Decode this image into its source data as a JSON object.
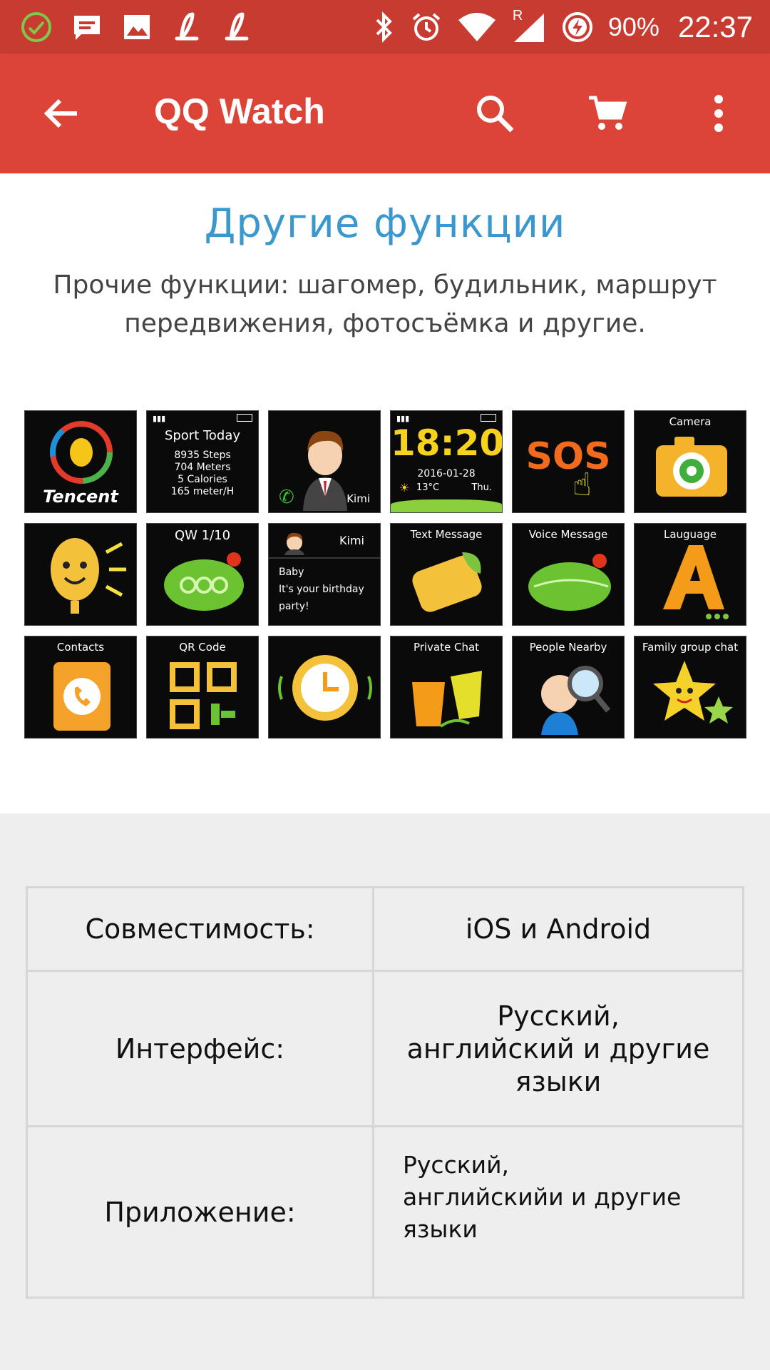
{
  "status_bar": {
    "battery_percent": "90%",
    "time": "22:37",
    "network_roaming_label": "R",
    "left_icons": [
      "check-circle-icon",
      "message-icon",
      "image-icon",
      "script-l-icon",
      "script-l-icon"
    ],
    "right_icons": [
      "bluetooth-icon",
      "alarm-icon",
      "wifi-icon",
      "cell-signal-icon",
      "battery-charging-icon"
    ]
  },
  "toolbar": {
    "title": "QQ Watch",
    "back_icon": "arrow-back-icon",
    "search_icon": "search-icon",
    "cart_icon": "shopping-cart-icon",
    "more_icon": "more-vert-icon"
  },
  "colors": {
    "status_bar": "#c73b30",
    "toolbar": "#db4437",
    "heading": "#3a98cf",
    "page_bg": "#eeeeee"
  },
  "features": {
    "heading": "Другие функции",
    "description": "Прочие функции: шагомер, будильник, маршрут передвижения, фотосъёмка и другие."
  },
  "tiles": {
    "tencent": {
      "label": "Tencent"
    },
    "sport": {
      "title": "Sport Today",
      "lines": [
        "8935 Steps",
        "704 Meters",
        "5 Calories",
        "165 meter/H"
      ]
    },
    "contact_kimi": {
      "name": "Kimi"
    },
    "clock": {
      "time": "18:20",
      "date": "2016-01-28",
      "temp": "13°C",
      "day": "Thu."
    },
    "sos": {
      "label": "SOS"
    },
    "camera": {
      "label": "Camera"
    },
    "mic": {
      "label": ""
    },
    "qw": {
      "label": "QW 1/10"
    },
    "birthday": {
      "name": "Kimi",
      "lines": [
        "Baby",
        "It's your birthday",
        "party!"
      ]
    },
    "text_message": {
      "label": "Text Message"
    },
    "voice_message": {
      "label": "Voice Message"
    },
    "language": {
      "label": "Lauguage"
    },
    "contacts": {
      "label": "Contacts"
    },
    "qr_code": {
      "label": "QR Code"
    },
    "alarm": {
      "label": ""
    },
    "private_chat": {
      "label": "Private Chat"
    },
    "people_nearby": {
      "label": "People Nearby"
    },
    "family_chat": {
      "label": "Family group chat"
    }
  },
  "specs": {
    "rows": [
      {
        "label": "Совместимость:",
        "value": "iOS и Android"
      },
      {
        "label": "Интерфейс:",
        "value_lines": [
          "Русский,",
          "английский и другие",
          "языки"
        ]
      },
      {
        "label": "Приложение:",
        "value_lines": [
          "Русский,",
          "английскийи и другие",
          "языки"
        ]
      }
    ]
  }
}
